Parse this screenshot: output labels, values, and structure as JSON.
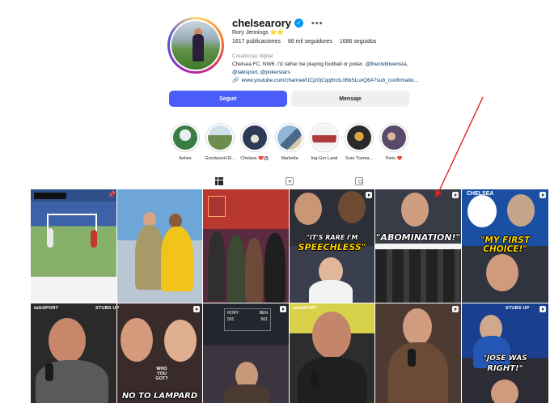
{
  "profile": {
    "username": "chelsearory",
    "full_name": "Rory Jennings ⭐⭐",
    "more_label": "•••",
    "stats": {
      "posts": "1617 publicaciones",
      "followers": "66 mil seguidores",
      "following": "1686 seguidos"
    },
    "category": "Creador(a) digital",
    "bio_text": "Chelsea FC. NW6. I'd rather be playing football or poker.",
    "mention_1": "@theclubliveinsta,",
    "mention_2": "@talksport",
    "mention_sep": ", ",
    "mention_3": "@pokerstars",
    "link": "www.youtube.com/channel/UCjz0jCqq6rcIL06bSLuvQ6A?sub_confirmatio..."
  },
  "buttons": {
    "follow": "Seguir",
    "message": "Mensaje"
  },
  "highlights": [
    {
      "label": "Ashes",
      "color": "#3a7d44"
    },
    {
      "label": "Goodwood El...",
      "color": "#6b8e4e"
    },
    {
      "label": "Chelsea ❤️⚽",
      "color": "#2b3a55"
    },
    {
      "label": "Marbella",
      "color": "#4a6a8a"
    },
    {
      "label": "Ing-Ger-Land",
      "color": "#b03a3a"
    },
    {
      "label": "Sure Touma...",
      "color": "#2a2a2a"
    },
    {
      "label": "Paris ❤️",
      "color": "#5a4a6a"
    }
  ],
  "tabs": [
    "posts-tab",
    "reels-tab",
    "tagged-tab"
  ],
  "posts": {
    "p2_caption": "",
    "p4_caption_1": "\"IT'S RARE I'M",
    "p4_caption_2": "SPEECHLESS\"",
    "p5_caption": "\"ABOMINATION!\"",
    "p6_top": "CHELSEA",
    "p6_caption": "\"MY FIRST CHOICE!\"",
    "p7_watermark": "talkSPORT",
    "p7_stubs": "STUBS UP",
    "p8_text_1": "WHO",
    "p8_text_2": "YOU",
    "p8_text_3": "GOT?",
    "p8_caption": "NO TO LAMPARD",
    "p9_left": "RORY",
    "p9_right": "BEN",
    "p9_left_score": "501",
    "p9_right_score": "501",
    "p11_watermark": "talkSPORT",
    "p12_stubs": "STUBS UP",
    "p12_caption_1": "\"JOSE WAS",
    "p12_caption_2": "RIGHT!\""
  },
  "colors": {
    "accent_button": "#4a5df9",
    "link": "#00376b",
    "verified": "#0095f6",
    "annotation_arrow": "#e02020"
  }
}
